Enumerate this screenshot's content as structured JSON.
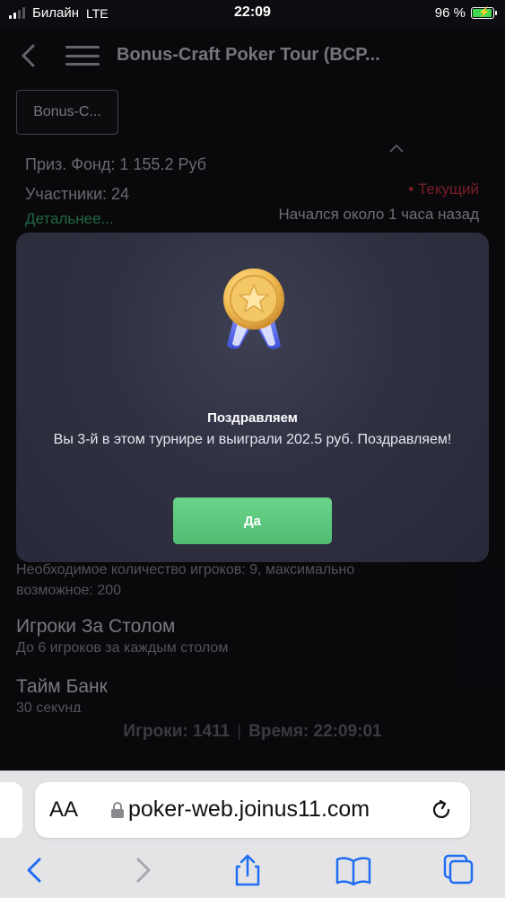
{
  "status_bar": {
    "carrier": "Билайн",
    "network": "LTE",
    "time": "22:09",
    "battery": "96 %"
  },
  "header": {
    "title": "Bonus-Craft Poker Tour (BCP..."
  },
  "tournament": {
    "chip_label": "Bonus-C...",
    "prize_fund": "Приз. Фонд: 1 155.2 Руб",
    "participants": "Участники: 24",
    "details_link": "Детальнее...",
    "status": "• Текущий",
    "started": "Начался около 1 часа назад"
  },
  "sections": {
    "requirements": "Необходимое количество игроков: 9, максимально возможное: 200",
    "players_at_table_title": "Игроки За Столом",
    "players_at_table_sub": "До 6 игроков за каждым столом",
    "time_bank_title": "Тайм Банк",
    "time_bank_sub": "30 секунд"
  },
  "footer": {
    "players": "Игроки: 1411",
    "separator": "|",
    "time": "Время: 22:09:01"
  },
  "modal": {
    "title": "Поздравляем",
    "message": "Вы 3-й в этом турнире и выиграли 202.5 руб. Поздравляем!",
    "ok_label": "Да",
    "medal_icon": "gold-medal-star-icon"
  },
  "browser": {
    "aa_label": "AA",
    "url": "poker-web.joinus11.com"
  },
  "colors": {
    "accent_green": "#5bc77b",
    "status_red": "#e8394b",
    "link_green": "#3ec27a"
  }
}
